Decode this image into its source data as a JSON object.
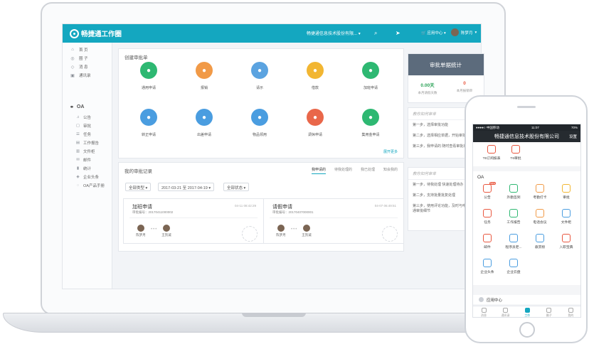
{
  "header": {
    "logo": "畅捷通工作圈",
    "company": "畅捷通信息技术股份有限...",
    "app_center": "应用中心",
    "user_name": "陈梦月"
  },
  "sidebar": {
    "items": [
      {
        "label": "首 页",
        "icon": "home-icon"
      },
      {
        "label": "圈 子",
        "icon": "circle-icon"
      },
      {
        "label": "消 息",
        "icon": "message-icon"
      },
      {
        "label": "通讯录",
        "icon": "contacts-icon"
      }
    ],
    "oa_title": "OA",
    "oa_items": [
      {
        "label": "公告",
        "icon": "bell-icon"
      },
      {
        "label": "审批",
        "icon": "approve-icon"
      },
      {
        "label": "任务",
        "icon": "task-icon"
      },
      {
        "label": "工作报告",
        "icon": "report-icon"
      },
      {
        "label": "文件柜",
        "icon": "cabinet-icon"
      },
      {
        "label": "邮件",
        "icon": "mail-icon"
      },
      {
        "label": "统计",
        "icon": "stats-icon"
      },
      {
        "label": "企业头条",
        "icon": "headline-icon"
      },
      {
        "label": "OA产品手册",
        "icon": "manual-icon"
      }
    ]
  },
  "create_panel": {
    "title": "创建审批单",
    "items": [
      {
        "label": "通用申请",
        "color": "#2eb872",
        "icon": "chat-icon"
      },
      {
        "label": "报销",
        "color": "#f19a47",
        "icon": "reimburse-icon"
      },
      {
        "label": "请示",
        "color": "#5ba3e0",
        "icon": "request-icon"
      },
      {
        "label": "借款",
        "color": "#f2b632",
        "icon": "loan-icon"
      },
      {
        "label": "加班申请",
        "color": "#2eb872",
        "icon": "overtime-icon"
      },
      {
        "label": "转正申请",
        "color": "#4a9de0",
        "icon": "regular-icon"
      },
      {
        "label": "出差申请",
        "color": "#4a9de0",
        "icon": "trip-icon"
      },
      {
        "label": "物品领用",
        "color": "#4a9de0",
        "icon": "goods-icon"
      },
      {
        "label": "调休申请",
        "color": "#e9674a",
        "icon": "leave-swap-icon"
      },
      {
        "label": "集用金申请",
        "color": "#2eb872",
        "icon": "fund-icon"
      }
    ],
    "more": "展开更多"
  },
  "records_panel": {
    "title": "我的审批记录",
    "tabs": [
      "我申请的",
      "待我处理的",
      "我已处理",
      "知会我的"
    ],
    "filters": {
      "type": "全部类型",
      "date_range": "2017-03-21 至 2017-04-19",
      "status": "全部状态"
    },
    "cards": [
      {
        "title": "加班申请",
        "date": "04-11 08:42:29",
        "number": "审批编号：20170411000002",
        "from": "陈梦月",
        "to": "王凯诚"
      },
      {
        "title": "请假申请",
        "date": "04-07 06:49:51",
        "number": "审批编号：20170407000001",
        "from": "陈梦月",
        "to": "王凯诚"
      }
    ]
  },
  "stats": {
    "banner": "审批单据统计",
    "items": [
      {
        "value": "0.00天",
        "label": "本月请假天数"
      },
      {
        "value": "0",
        "label": "本月报销单"
      }
    ]
  },
  "help1": {
    "title": "教你如何审单",
    "steps": [
      "第一步，选择审批功能",
      "第二步，选择相应单据，开始审批",
      "第三步，我申请的 随时查看审批状态"
    ]
  },
  "help2": {
    "title": "教你如何审单",
    "steps": [
      "第一步，待我处理 快速处理待办",
      "第二步，支持批量批复处理",
      "第三步，使用评论功能，及时与申请人沟通审批细节"
    ]
  },
  "phone": {
    "status_left": "●●●●○ 中国移动",
    "status_time": "11:07",
    "status_right": "70%",
    "title": "畅捷通信息技术股份有限公司",
    "settings": "设置",
    "top_apps": [
      {
        "label": "T6订阅报表",
        "icon": "subscribe-icon"
      },
      {
        "label": "T6审批",
        "icon": "t6-approve-icon"
      }
    ],
    "oa_title": "OA",
    "oa_apps": [
      {
        "label": "公告",
        "icon": "bell-icon",
        "color": "#e9573f",
        "badge": "New"
      },
      {
        "label": "外勤签到",
        "icon": "checkin-icon",
        "color": "#2eb872"
      },
      {
        "label": "考勤打卡",
        "icon": "clock-icon",
        "color": "#f19a47"
      },
      {
        "label": "审批",
        "icon": "approve-icon",
        "color": "#f2b632"
      },
      {
        "label": "任务",
        "icon": "task-icon",
        "color": "#e9573f"
      },
      {
        "label": "工作报告",
        "icon": "report-icon",
        "color": "#2eb872"
      },
      {
        "label": "电话会议",
        "icon": "phone-icon",
        "color": "#f19a47"
      },
      {
        "label": "文件柜",
        "icon": "cabinet-icon",
        "color": "#4a9de0"
      },
      {
        "label": "邮件",
        "icon": "mail-icon",
        "color": "#e9573f"
      },
      {
        "label": "程序员老...",
        "icon": "code-icon",
        "color": "#4a9de0"
      },
      {
        "label": "悬赏榜",
        "icon": "reward-icon",
        "color": "#4a9de0"
      },
      {
        "label": "入职宝典",
        "icon": "book-icon",
        "color": "#e9573f"
      },
      {
        "label": "企业头条",
        "icon": "headline-icon",
        "color": "#4a9de0"
      },
      {
        "label": "企业云盘",
        "icon": "cloud-icon",
        "color": "#4a9de0"
      }
    ],
    "app_center": "应用中心",
    "tabs": [
      "消息",
      "通讯录",
      "工作",
      "圈子",
      "我的"
    ]
  }
}
